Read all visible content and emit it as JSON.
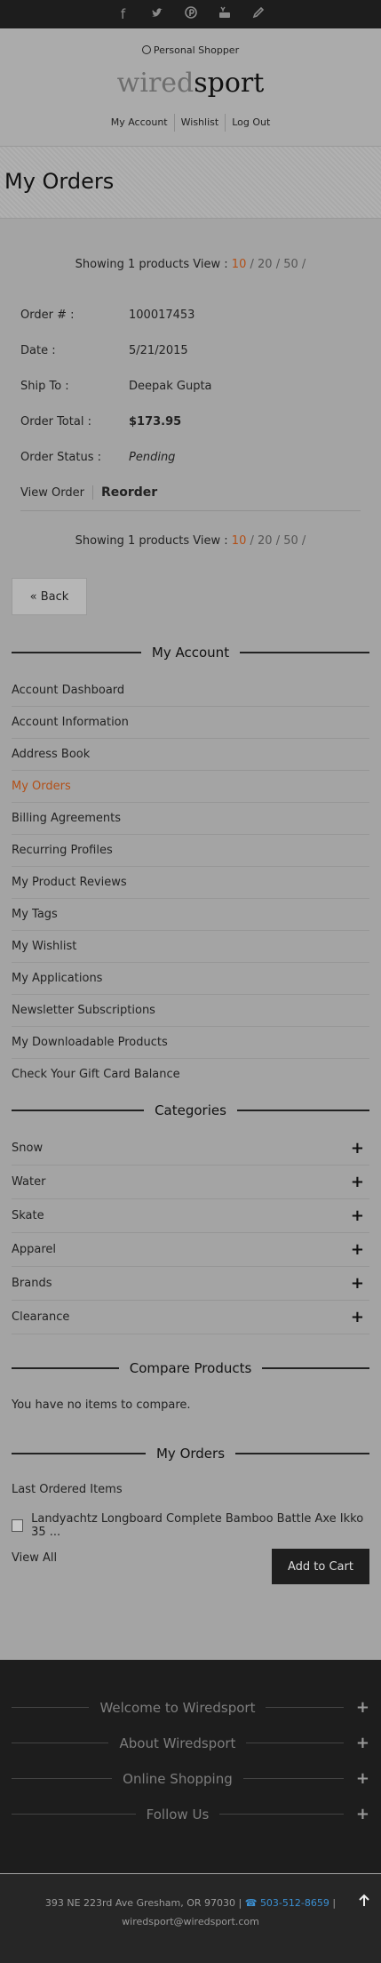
{
  "social": [
    "f",
    "t",
    "p",
    "yt",
    "✎"
  ],
  "header": {
    "shopper_label": "Personal Shopper",
    "logo_wired": "wired",
    "logo_sport": "sport",
    "nav": [
      "My Account",
      "Wishlist",
      "Log Out"
    ]
  },
  "page_title": "My Orders",
  "pager": {
    "showing": "Showing 1 products View :",
    "current": "10",
    "sep1": "/",
    "opt2": "20",
    "sep2": "/",
    "opt3": "50",
    "sep3": "/"
  },
  "order": {
    "number_label": "Order # :",
    "number": "100017453",
    "date_label": "Date :",
    "date": "5/21/2015",
    "ship_label": "Ship To :",
    "ship": "Deepak Gupta",
    "total_label": "Order Total :",
    "total": "$173.95",
    "status_label": "Order Status :",
    "status": "Pending",
    "view": "View Order",
    "reorder": "Reorder"
  },
  "back_button": "« Back",
  "my_account": {
    "heading": "My Account",
    "items": [
      "Account Dashboard",
      "Account Information",
      "Address Book",
      "My Orders",
      "Billing Agreements",
      "Recurring Profiles",
      "My Product Reviews",
      "My Tags",
      "My Wishlist",
      "My Applications",
      "Newsletter Subscriptions",
      "My Downloadable Products",
      "Check Your Gift Card Balance"
    ]
  },
  "categories": {
    "heading": "Categories",
    "items": [
      "Snow",
      "Water",
      "Skate",
      "Apparel",
      "Brands",
      "Clearance"
    ]
  },
  "compare": {
    "heading": "Compare Products",
    "empty": "You have no items to compare."
  },
  "recent_orders": {
    "heading": "My Orders",
    "sub": "Last Ordered Items",
    "item": "Landyachtz Longboard Complete Bamboo Battle Axe Ikko 35 ...",
    "view_all": "View All",
    "add_to_cart": "Add to Cart"
  },
  "footer": {
    "sections": [
      "Welcome to Wiredsport",
      "About Wiredsport",
      "Online Shopping",
      "Follow Us"
    ],
    "address": "393 NE 223rd Ave Gresham, OR 97030 |",
    "phone": "503-512-8659",
    "phone_sep": "|",
    "email": "wiredsport@wiredsport.com"
  },
  "colors": {
    "accent": "#b34f16",
    "dark": "#1d1d1d",
    "bg": "#a4a4a4"
  }
}
